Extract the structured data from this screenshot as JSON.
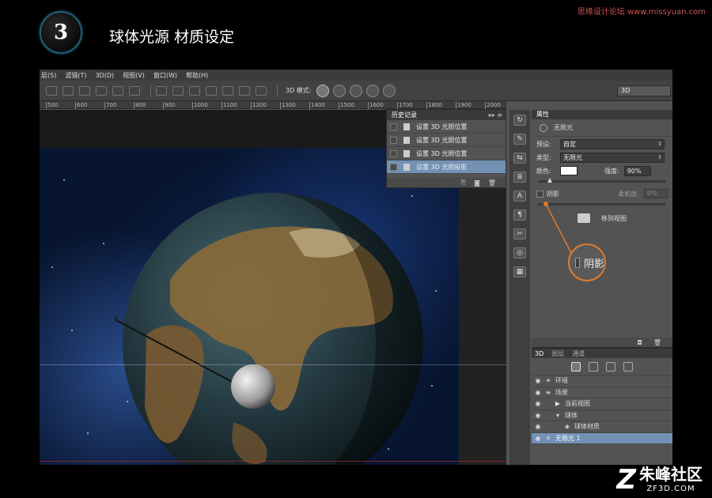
{
  "tutorial": {
    "step": "3",
    "title": "球体光源 材质设定",
    "watermark_top": "思缘设计论坛 www.missyuan.com"
  },
  "menu": [
    "层(S)",
    "滤镜(T)",
    "3D(D)",
    "视图(V)",
    "窗口(W)",
    "帮助(H)"
  ],
  "options_bar": {
    "mode_label": "3D 模式:",
    "workspace": "3D"
  },
  "ruler": [
    "500",
    "600",
    "700",
    "800",
    "900",
    "1000",
    "1100",
    "1200",
    "1300",
    "1400",
    "1500",
    "1600",
    "1700",
    "1800",
    "1900",
    "2000"
  ],
  "history": {
    "tab": "历史记录",
    "collapse": "▸▸ ≡",
    "rows": [
      "设置 3D 光照位置",
      "设置 3D 光照位置",
      "设置 3D 光照位置",
      "设置 3D 光照投影"
    ],
    "footer_icons": [
      "⎘",
      "◙",
      "🗑"
    ]
  },
  "toolstrip": [
    "↻",
    "✎",
    "⇆",
    "≣",
    "A",
    "¶",
    "✂",
    "◎",
    "▦"
  ],
  "properties": {
    "tab": "属性",
    "header": "无限光",
    "preset_label": "预设:",
    "preset_value": "自定",
    "type_label": "类型:",
    "type_value": "无限光",
    "color_label": "颜色:",
    "intensity_label": "强度:",
    "intensity_value": "90%",
    "intensity_level": 0.9,
    "shadow_label": "阴影",
    "softness_label": "柔和度:",
    "softness_value": "0%",
    "move_to_view": "移到视图",
    "footer_icons": [
      "◘",
      "🗑"
    ]
  },
  "zoom_callout": {
    "label": "阴影"
  },
  "panel3d": {
    "tabs": [
      "3D",
      "图层",
      "通道"
    ],
    "items": [
      {
        "glyph": "☀",
        "label": "环境",
        "indent": 0,
        "active": false
      },
      {
        "glyph": "≡",
        "label": "场景",
        "indent": 0,
        "active": false
      },
      {
        "glyph": "▶",
        "label": "当前视图",
        "indent": 1,
        "active": false
      },
      {
        "glyph": "▾",
        "label": "球体",
        "indent": 1,
        "active": false
      },
      {
        "glyph": "◈",
        "label": "球体材质",
        "indent": 2,
        "active": false
      },
      {
        "glyph": "✳",
        "label": "无限光 1",
        "indent": 0,
        "active": true
      }
    ]
  },
  "logo": {
    "cn": "朱峰社区",
    "en": "ZF3D.COM"
  },
  "colors": {
    "accent": "#e07a2a",
    "selection": "#7391b5",
    "panel": "#535353"
  }
}
